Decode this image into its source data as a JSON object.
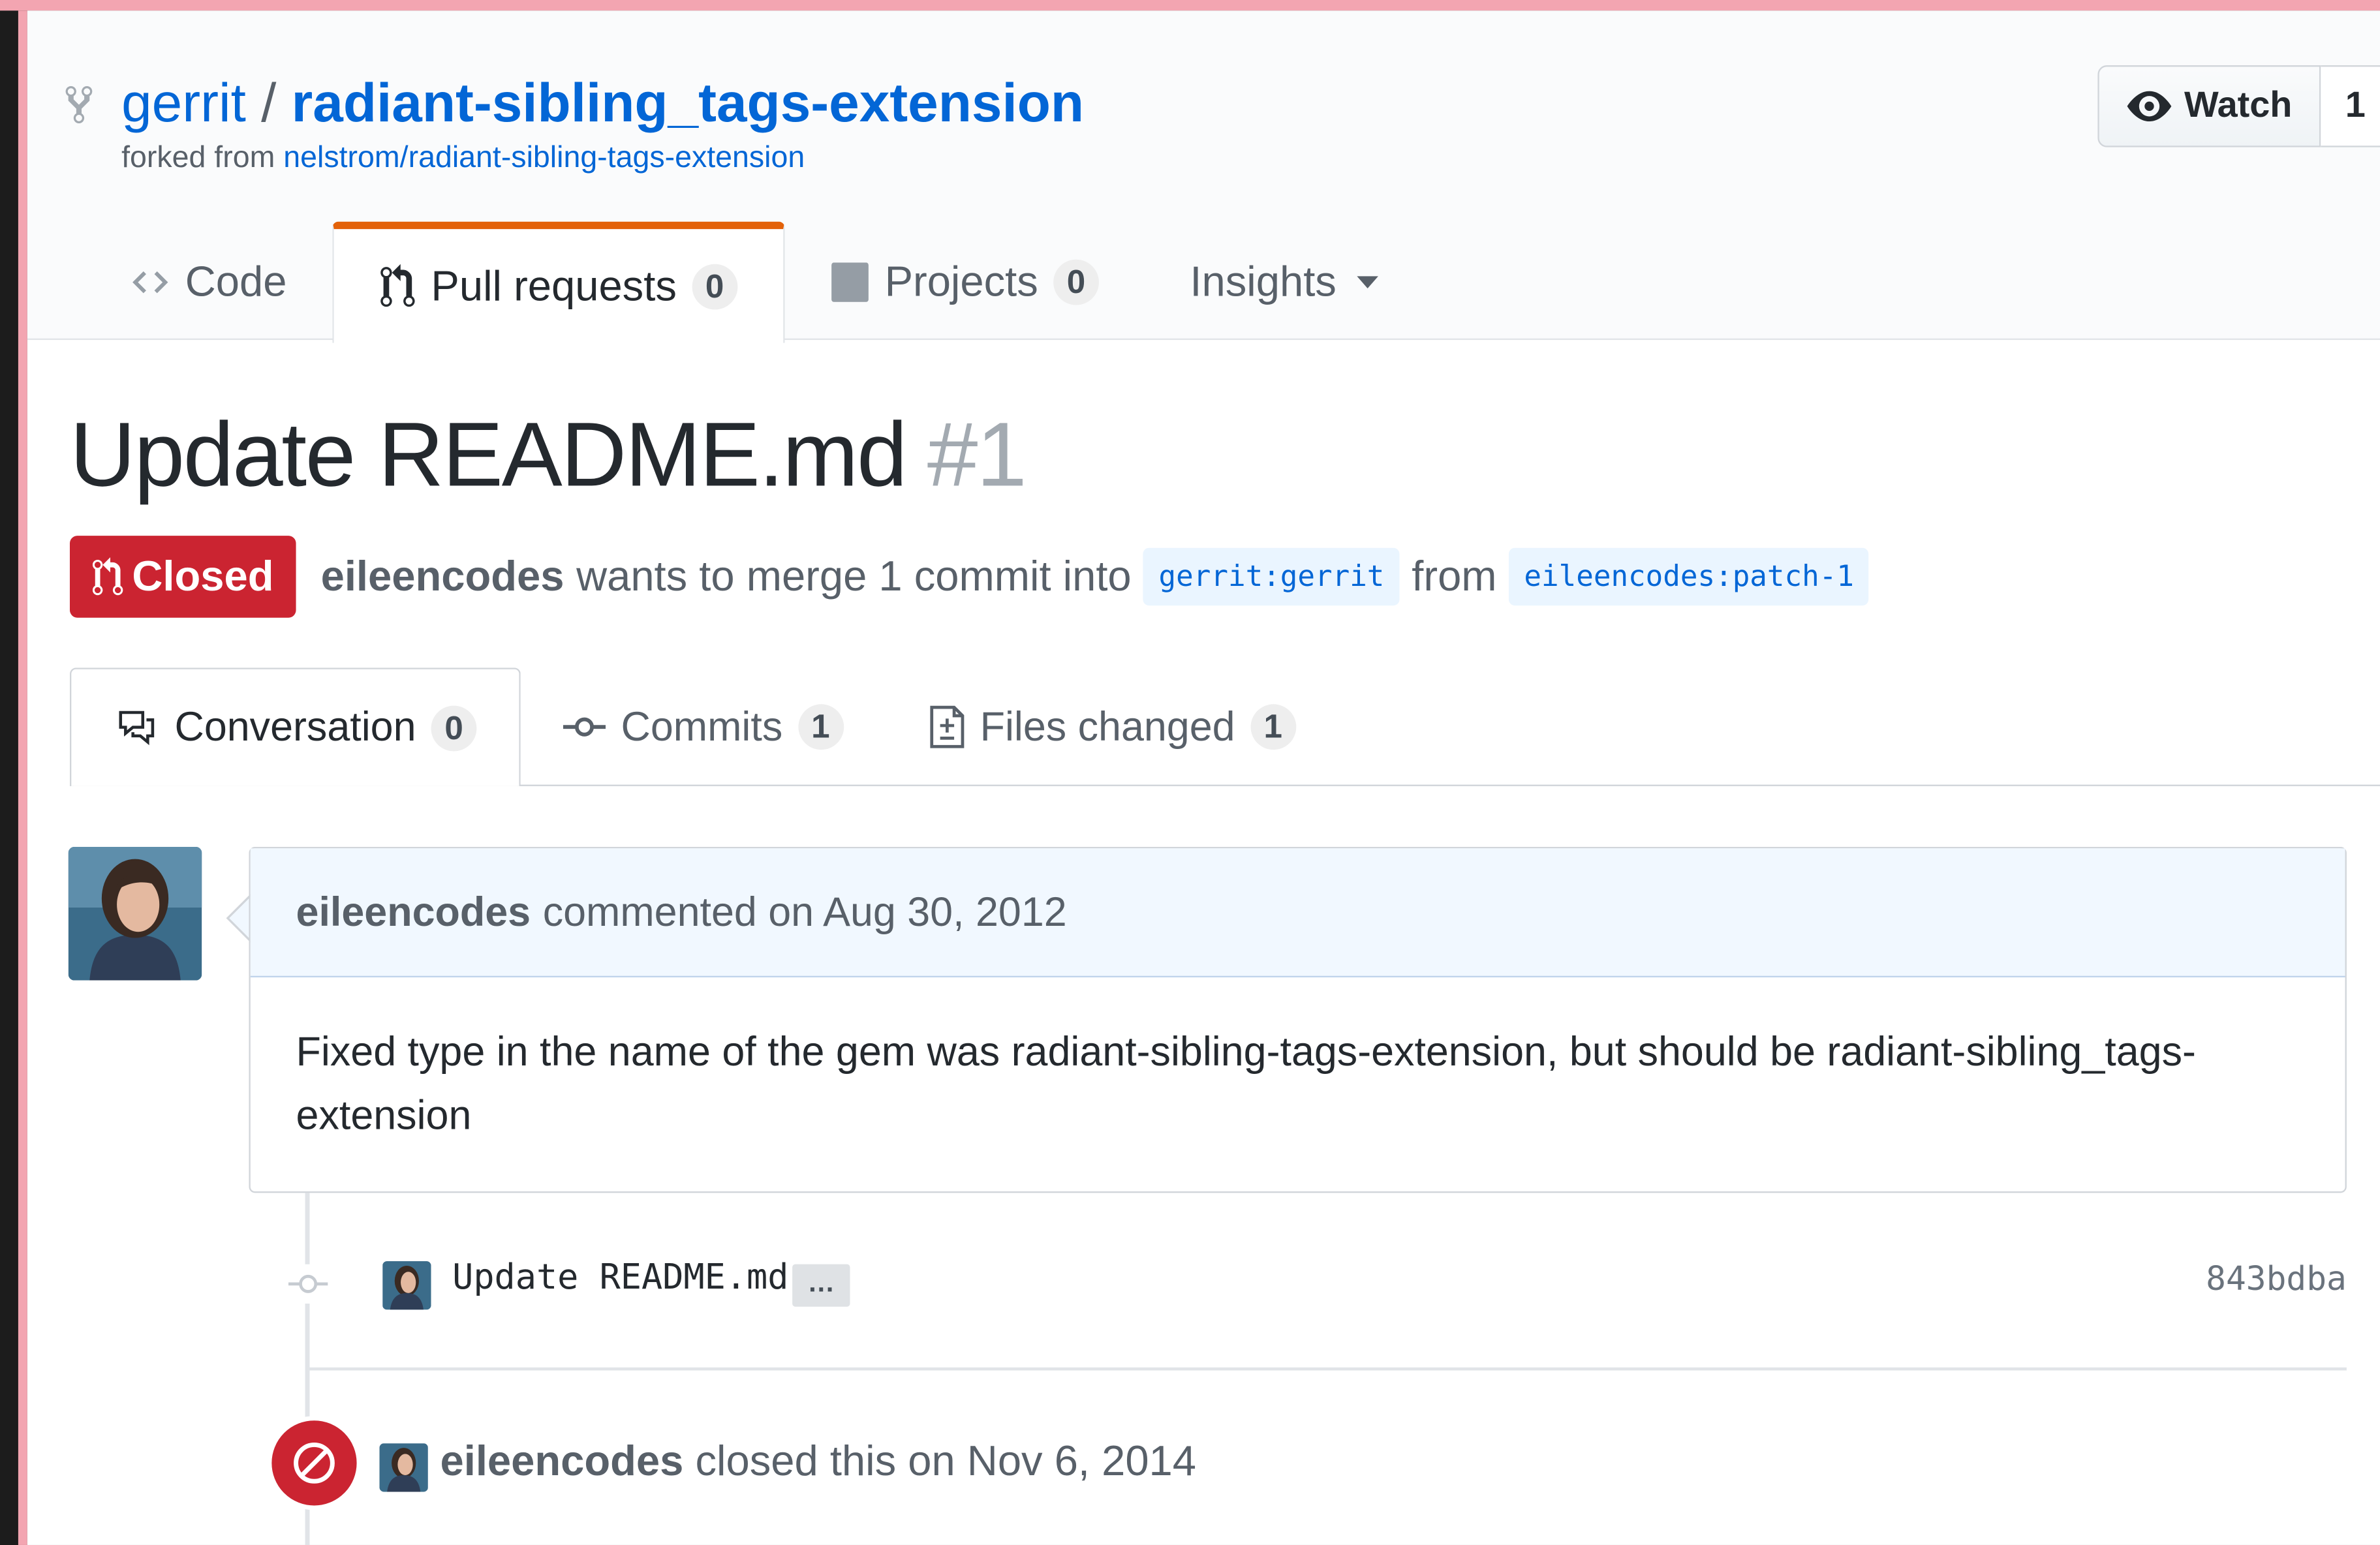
{
  "repo": {
    "owner": "gerrit",
    "name": "radiant-sibling_tags-extension",
    "forked_prefix": "forked from",
    "forked_from": "nelstrom/radiant-sibling-tags-extension",
    "watch_label": "Watch",
    "watch_count": "1"
  },
  "reponav": {
    "code": "Code",
    "pull_requests": "Pull requests",
    "pull_requests_count": "0",
    "projects": "Projects",
    "projects_count": "0",
    "insights": "Insights"
  },
  "pr": {
    "title": "Update README.md",
    "number": "#1",
    "state": "Closed",
    "author": "eileencodes",
    "merge_text": "wants to merge 1 commit into",
    "base_ref": "gerrit:gerrit",
    "from_text": "from",
    "head_ref": "eileencodes:patch-1"
  },
  "tabs": {
    "conversation": "Conversation",
    "conversation_count": "0",
    "commits": "Commits",
    "commits_count": "1",
    "files_changed": "Files changed",
    "files_changed_count": "1"
  },
  "comment": {
    "author": "eileencodes",
    "action": "commented on Aug 30, 2012",
    "body": "Fixed type in the name of the gem was radiant-sibling-tags-extension, but should be radiant-sibling_tags-extension"
  },
  "commit": {
    "message": "Update README.md",
    "ellipsis": "…",
    "sha": "843bdba"
  },
  "event": {
    "author": "eileencodes",
    "action": "closed this on Nov 6, 2014"
  },
  "colors": {
    "link": "#0366d6",
    "closed_red": "#cb2431",
    "selected_tab_accent": "#e36209"
  }
}
